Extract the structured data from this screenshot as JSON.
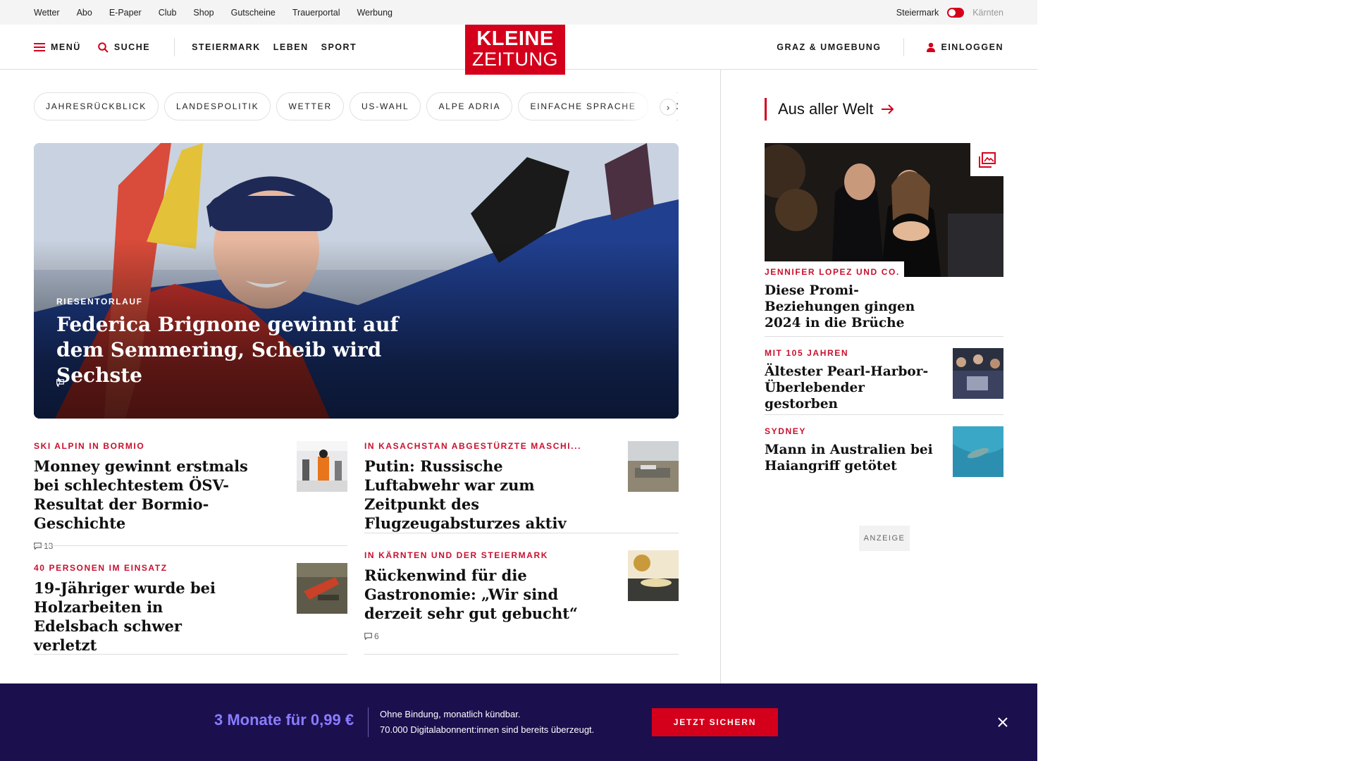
{
  "topbar": {
    "links": [
      "Wetter",
      "Abo",
      "E-Paper",
      "Club",
      "Shop",
      "Gutscheine",
      "Trauerportal",
      "Werbung"
    ],
    "region_active": "Steiermark",
    "region_inactive": "Kärnten"
  },
  "header": {
    "menu_label": "MENÜ",
    "search_label": "SUCHE",
    "nav": [
      "STEIERMARK",
      "LEBEN",
      "SPORT"
    ],
    "logo_line1": "KLEINE",
    "logo_line2": "ZEITUNG",
    "region_link": "GRAZ & UMGEBUNG",
    "login_label": "EINLOGGEN"
  },
  "tags": [
    "JAHRESRÜCKBLICK",
    "LANDESPOLITIK",
    "WETTER",
    "US-WAHL",
    "ALPE ADRIA",
    "EINFACHE SPRACHE",
    "DO"
  ],
  "hero": {
    "kicker": "RIESENTORLAUF",
    "title": "Federica Brignone gewinnt auf dem Semmering, Scheib wird Sechste",
    "comments": "7"
  },
  "articles": [
    {
      "kicker": "SKI ALPIN IN BORMIO",
      "title": "Monney gewinnt erstmals bei schlechtestem ÖSV-Resultat der Bormio-Geschichte",
      "comments": "13"
    },
    {
      "kicker": "IN KASACHSTAN ABGESTÜRZTE MASCHI...",
      "title": "Putin: Russische Luftabwehr war zum Zeitpunkt des Flugzeugabsturzes aktiv",
      "comments": ""
    },
    {
      "kicker": "40 PERSONEN IM EINSATZ",
      "title": "19-Jähriger wurde bei Holzarbeiten in Edelsbach schwer verletzt",
      "comments": ""
    },
    {
      "kicker": "IN KÄRNTEN UND DER STEIERMARK",
      "title": "Rückenwind für die Gastronomie: „Wir sind derzeit sehr gut gebucht“",
      "comments": "6"
    }
  ],
  "sidebar": {
    "heading": "Aus aller Welt",
    "lead": {
      "kicker": "JENNIFER LOPEZ UND CO.",
      "title": "Diese Promi-Beziehungen gingen 2024 in die Brüche"
    },
    "items": [
      {
        "kicker": "MIT 105 JAHREN",
        "title": "Ältester Pearl-Harbor-Überlebender gestorben"
      },
      {
        "kicker": "SYDNEY",
        "title": "Mann in Australien bei Haiangriff getötet"
      }
    ],
    "ad_label": "ANZEIGE"
  },
  "promo": {
    "price": "3 Monate für 0,99 €",
    "line1": "Ohne Bindung, monatlich kündbar.",
    "line2": "70.000 Digitalabonnent:innen sind bereits überzeugt.",
    "cta": "JETZT SICHERN"
  },
  "colors": {
    "brand_red": "#d4001b",
    "kicker_red": "#c8102e",
    "promo_bg": "#1b0f4e",
    "promo_price": "#8a7cff"
  }
}
